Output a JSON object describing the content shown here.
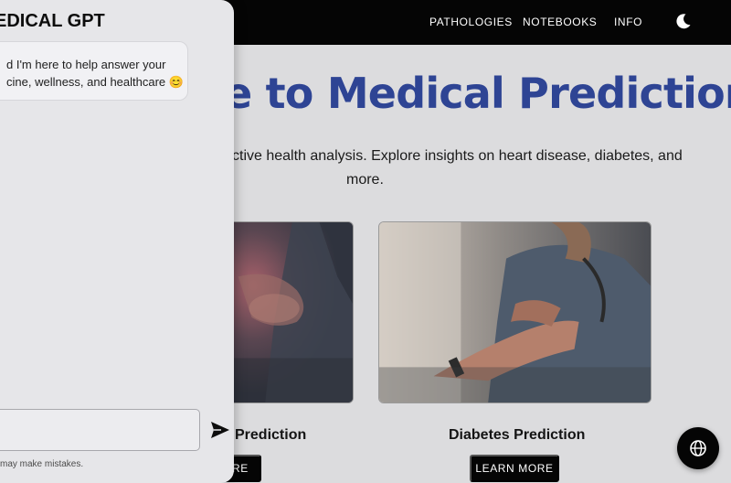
{
  "nav": {
    "items": [
      {
        "label": "PATHOLOGIES"
      },
      {
        "label": "NOTEBOOKS"
      },
      {
        "label": "INFO"
      }
    ],
    "theme_icon": "moon-icon"
  },
  "hero": {
    "title": "e to Medical Prediction",
    "subtitle_line1": "ctive health analysis. Explore insights on heart disease, diabetes, and",
    "subtitle_line2": "more."
  },
  "cards": [
    {
      "title": "Prediction",
      "button_label": "ORE",
      "image": "chest-pain-photo"
    },
    {
      "title": "Diabetes Prediction",
      "button_label": "LEARN MORE",
      "image": "nurse-checking-pulse-photo"
    }
  ],
  "chat": {
    "title": "EDICAL GPT",
    "message_line1": "d I'm here to help answer your",
    "message_line2": "cine, wellness, and healthcare 😊",
    "input_value": "",
    "send_icon": "send-icon",
    "disclaimer": "may make mistakes."
  },
  "fab": {
    "icon": "globe-icon"
  },
  "colors": {
    "nav_background": "#050505",
    "title_color": "#2e4494",
    "page_background": "#dcdcde",
    "drawer_background": "#e6e6e9"
  }
}
